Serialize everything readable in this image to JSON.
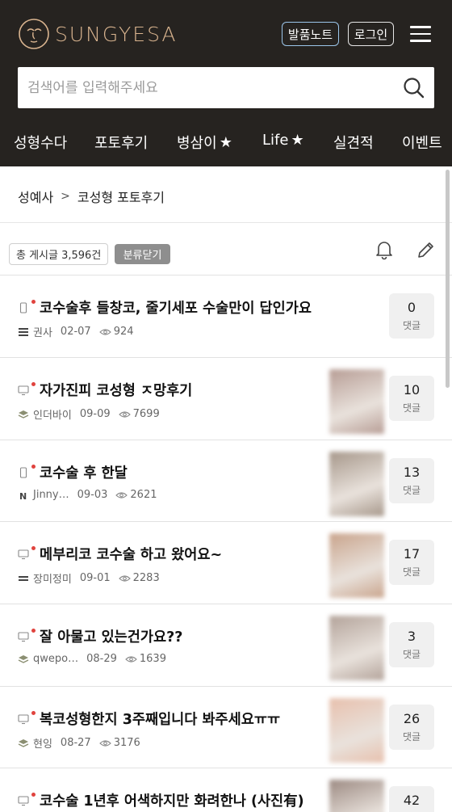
{
  "header": {
    "brand": "SUNGYESA",
    "note_button": "발품노트",
    "login_button": "로그인",
    "search_placeholder": "검색어를 입력해주세요"
  },
  "nav": {
    "items": [
      {
        "label": "성형수다",
        "star": false
      },
      {
        "label": "포토후기",
        "star": false
      },
      {
        "label": "병삼이",
        "star": true
      },
      {
        "label": "Life",
        "star": true
      },
      {
        "label": "실견적",
        "star": false
      },
      {
        "label": "이벤트",
        "star": false
      }
    ]
  },
  "breadcrumb": {
    "root": "성예사",
    "separator": ">",
    "current": "코성형 포토후기"
  },
  "toolbar": {
    "total": "총 게시글 3,596건",
    "category_close": "분류닫기"
  },
  "comment_label": "댓글",
  "posts": [
    {
      "device": "mobile",
      "title": "코수술후 들창코, 줄기세포 수술만이 답인가요",
      "grade": "bars",
      "author": "권사",
      "date": "02-07",
      "views": "924",
      "comments": "0",
      "thumb": null
    },
    {
      "device": "pc",
      "title": "자가진피 코성형 ㅈ망후기",
      "grade": "layers",
      "author": "인더바이",
      "date": "09-09",
      "views": "7699",
      "comments": "10",
      "thumb": "#b79d95"
    },
    {
      "device": "mobile",
      "title": "코수술 후 한달",
      "grade": "N",
      "author": "Jinny…",
      "date": "09-03",
      "views": "2621",
      "comments": "13",
      "thumb": "#a6978a"
    },
    {
      "device": "pc",
      "title": "메부리코 코수술 하고 왔어요~",
      "grade": "bars2",
      "author": "장미정미",
      "date": "09-01",
      "views": "2283",
      "comments": "17",
      "thumb": "#c9a48c"
    },
    {
      "device": "pc",
      "title": "잘 아물고 있는건가요??",
      "grade": "layers",
      "author": "qwepo…",
      "date": "08-29",
      "views": "1639",
      "comments": "3",
      "thumb": "#b3a39a"
    },
    {
      "device": "pc",
      "title": "복코성형한지 3주째입니다 봐주세요ㅠㅠ",
      "grade": "layers",
      "author": "현잉",
      "date": "08-27",
      "views": "3176",
      "comments": "26",
      "thumb": "#e7c0ad"
    },
    {
      "device": "pc",
      "title": "코수술 1년후 어색하지만 화려한나 (사진有)",
      "grade": "layers",
      "author": "",
      "date": "",
      "views": "",
      "comments": "42",
      "thumb": "#9c8a82"
    }
  ]
}
